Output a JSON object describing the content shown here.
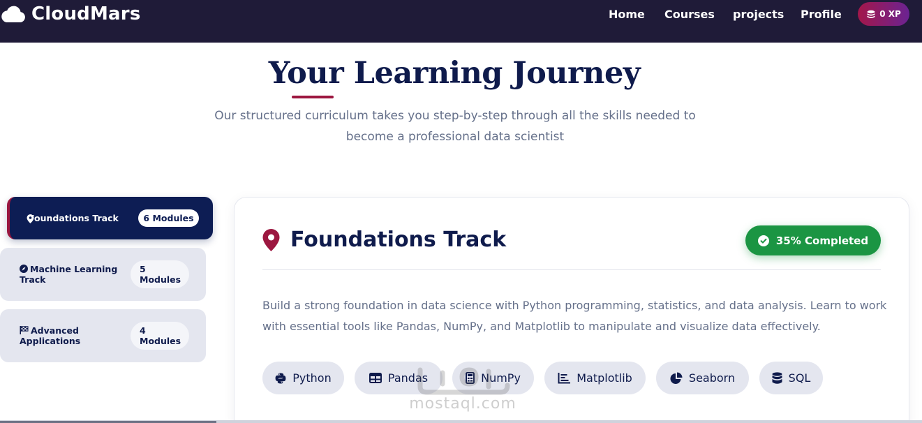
{
  "navbar": {
    "brand": "CloudMars",
    "links": [
      "Home",
      "Courses",
      "projects",
      "Profile"
    ],
    "xp": "0 XP"
  },
  "hero": {
    "title": "Your Learning Journey",
    "subtitle": "Our structured curriculum takes you step-by-step through all the skills needed to become a professional data scientist"
  },
  "tracks": [
    {
      "label": "Foundations Track",
      "modules": "6 Modules",
      "icon": "map-pin-icon",
      "active": true
    },
    {
      "label": "Machine Learning Track",
      "modules": "5 Modules",
      "icon": "compass-icon",
      "active": false
    },
    {
      "label": "Advanced Applications",
      "modules": "4 Modules",
      "icon": "flag-checkered-icon",
      "active": false
    }
  ],
  "card": {
    "title": "Foundations Track",
    "progress": "35% Completed",
    "progress_value": 0.35,
    "description": "Build a strong foundation in data science with Python programming, statistics, and data analysis. Learn to work with essential tools like Pandas, NumPy, and Matplotlib to manipulate and visualize data effectively.",
    "tools": [
      {
        "label": "Python",
        "icon": "python-icon"
      },
      {
        "label": "Pandas",
        "icon": "table-icon"
      },
      {
        "label": "NumPy",
        "icon": "calculator-icon"
      },
      {
        "label": "Matplotlib",
        "icon": "chart-bar-icon"
      },
      {
        "label": "Seaborn",
        "icon": "chart-pie-icon"
      },
      {
        "label": "SQL",
        "icon": "database-icon"
      }
    ]
  },
  "watermark": "mostaql.com",
  "colors": {
    "navbar": "#1f1b38",
    "navy": "#0f1b4c",
    "accent": "#9c1740",
    "success": "#1b9543",
    "chip": "#e4e6ef"
  }
}
